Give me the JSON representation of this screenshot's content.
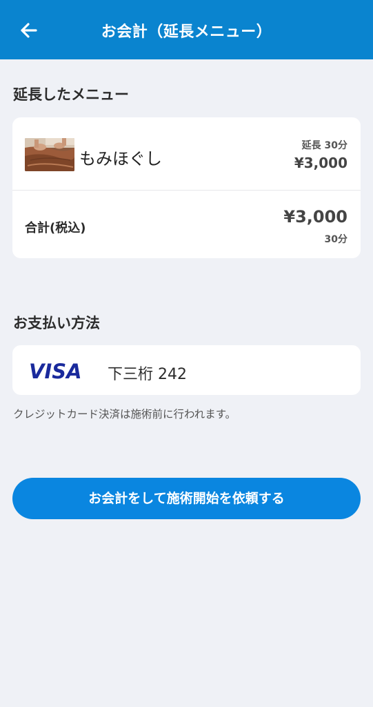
{
  "header": {
    "title": "お会計（延長メニュー）",
    "back_icon": "arrow-left-icon"
  },
  "extended_menu": {
    "section_title": "延長したメニュー",
    "items": [
      {
        "name": "もみほぐし",
        "extension_label": "延長 30分",
        "price": "¥3,000",
        "thumbnail": "massage-photo"
      }
    ],
    "total": {
      "label": "合計(税込)",
      "price": "¥3,000",
      "duration": "30分"
    }
  },
  "payment": {
    "section_title": "お支払い方法",
    "brand": "VISA",
    "card_label": "下三桁 242",
    "note": "クレジットカード決済は施術前に行われます。"
  },
  "actions": {
    "submit_label": "お会計をして施術開始を依頼する"
  },
  "colors": {
    "header_bg": "#0a84cf",
    "page_bg": "#eff1f6",
    "button_bg": "#0a86e0",
    "visa_blue": "#1a2a9c"
  }
}
